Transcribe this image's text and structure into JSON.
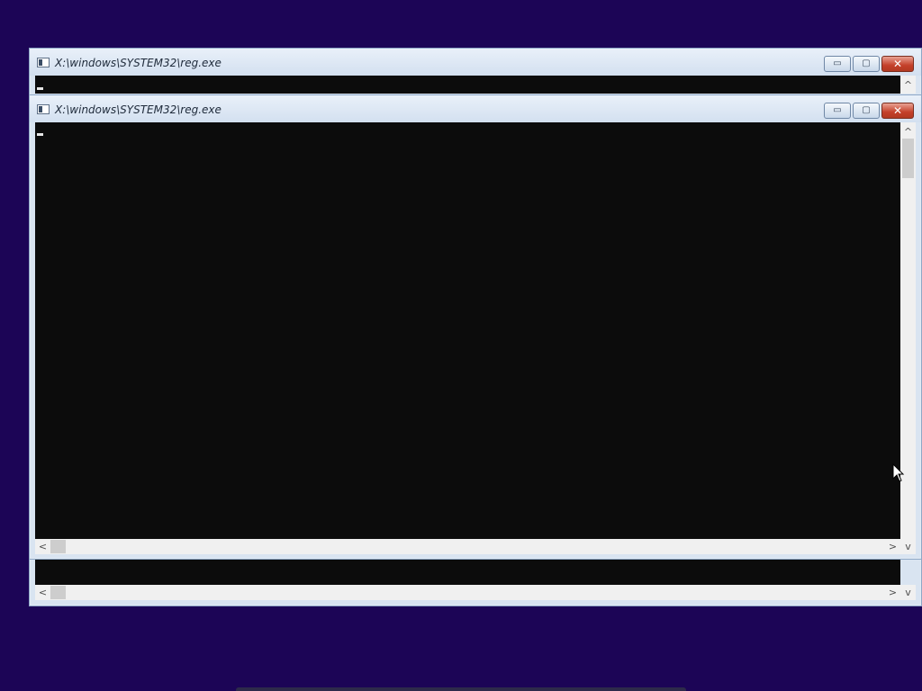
{
  "windows": {
    "back": {
      "title": "X:\\windows\\SYSTEM32\\reg.exe",
      "min_glyph": "▭",
      "max_glyph": "▢",
      "close_glyph": "✕"
    },
    "front": {
      "title": "X:\\windows\\SYSTEM32\\reg.exe",
      "min_glyph": "▭",
      "max_glyph": "▢",
      "close_glyph": "✕"
    }
  },
  "scroll": {
    "up": "^",
    "down": "v",
    "left": "<",
    "right": ">"
  },
  "colors": {
    "desktop": "#1c0556",
    "console": "#0c0c0c",
    "close_button": "#c4402a"
  },
  "icons": [
    "console-app-icon",
    "minimize-icon",
    "maximize-icon",
    "close-icon",
    "mouse-pointer-icon"
  ]
}
